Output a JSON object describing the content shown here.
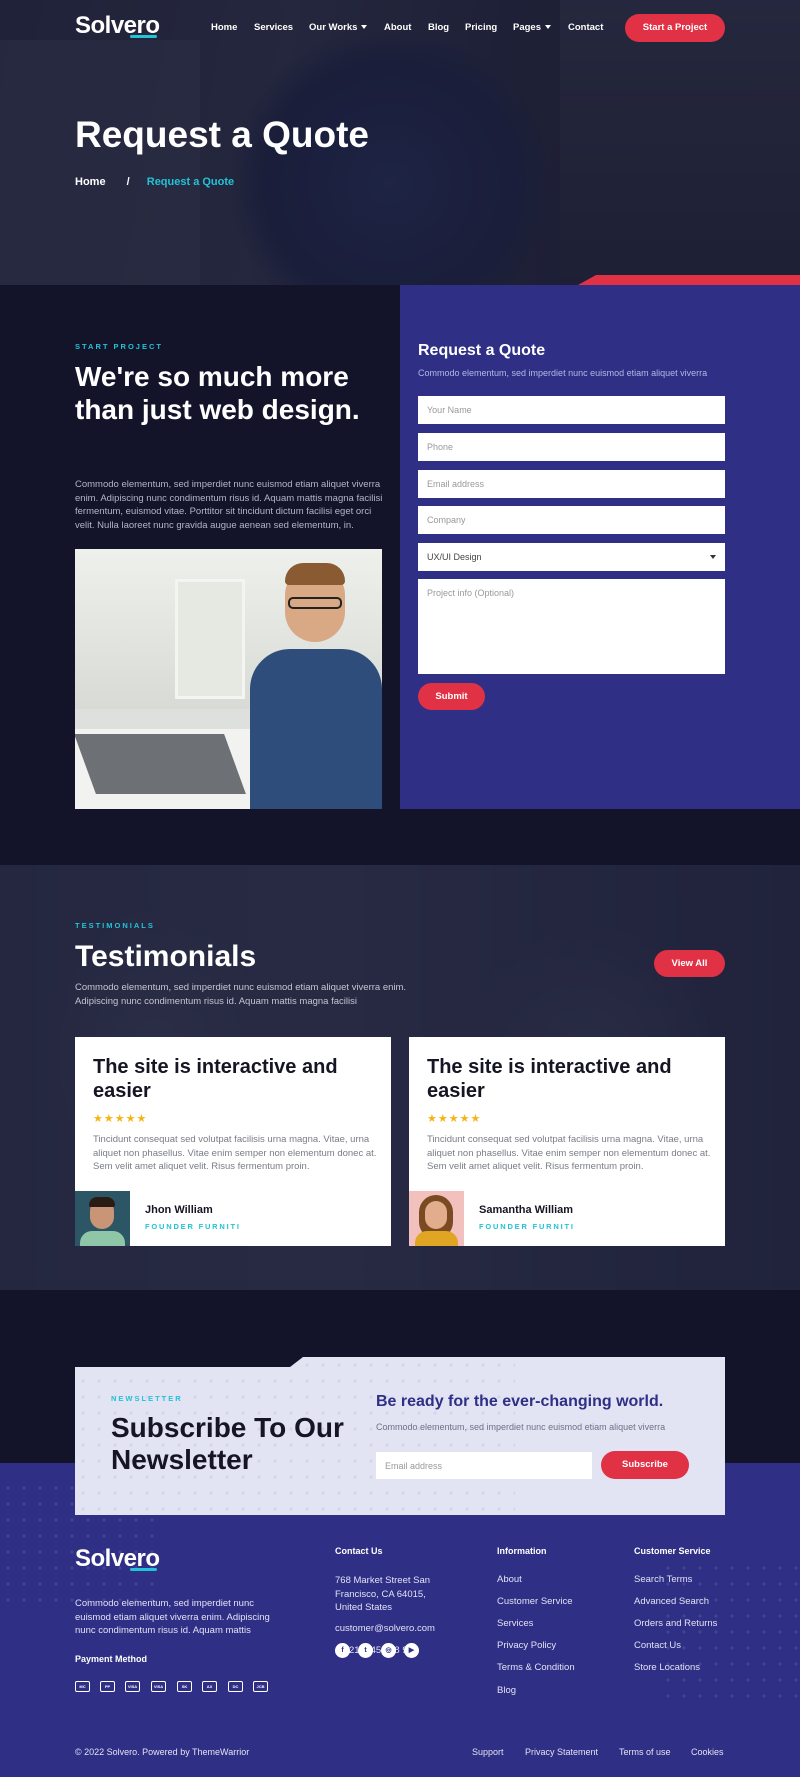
{
  "brand": {
    "name": "Solvero",
    "accent": "#e03145",
    "cyan": "#22c3d6",
    "indigo": "#2f2f86",
    "dark": "#131429"
  },
  "nav": {
    "items": [
      "Home",
      "Services",
      "Our Works",
      "About",
      "Blog",
      "Pricing",
      "Pages",
      "Contact"
    ],
    "cta": "Start a Project"
  },
  "hero": {
    "title": "Request a Quote",
    "breadcrumb": {
      "home": "Home",
      "separator": "/",
      "current": "Request a Quote"
    }
  },
  "intro": {
    "eyebrow": "START PROJECT",
    "title": "We're so much more than just web design.",
    "text": "Commodo elementum, sed imperdiet nunc euismod etiam aliquet viverra enim. Adipiscing nunc condimentum risus id. Aquam mattis magna facilisi fermentum, euismod vitae. Porttitor sit tincidunt dictum facilisi eget orci velit. Nulla laoreet nunc gravida augue aenean sed elementum, in."
  },
  "quote_form": {
    "title": "Request a Quote",
    "subtitle": "Commodo elementum, sed imperdiet nunc euismod etiam aliquet viverra",
    "name_placeholder": "Your Name",
    "phone_placeholder": "Phone",
    "email_placeholder": "Email address",
    "company_placeholder": "Company",
    "service_value": "UX/UI Design",
    "info_placeholder": "Project info (Optional)",
    "submit": "Submit"
  },
  "testimonials": {
    "eyebrow": "TESTIMONIALS",
    "title": "Testimonials",
    "text": "Commodo elementum, sed imperdiet nunc euismod etiam aliquet viverra enim. Adipiscing nunc condimentum risus id. Aquam mattis magna facilisi",
    "view_all": "View All",
    "cards": [
      {
        "title": "The site is interactive and easier",
        "rating": 5,
        "stars": "★★★★★",
        "text": "Tincidunt consequat sed volutpat facilisis urna magna. Vitae, urna aliquet non phasellus. Vitae enim semper non elementum donec at. Sem velit amet aliquet velit. Risus fermentum proin.",
        "author": "Jhon William",
        "role": "FOUNDER FURNITI"
      },
      {
        "title": "The site is interactive and easier",
        "rating": 5,
        "stars": "★★★★★",
        "text": "Tincidunt consequat sed volutpat facilisis urna magna. Vitae, urna aliquet non phasellus. Vitae enim semper non elementum donec at. Sem velit amet aliquet velit. Risus fermentum proin.",
        "author": "Samantha William",
        "role": "FOUNDER FURNITI"
      }
    ]
  },
  "newsletter": {
    "eyebrow": "NEWSLETTER",
    "title": "Subscribe To Our Newsletter",
    "heading": "Be ready for the ever-changing world.",
    "text": "Commodo elementum, sed imperdiet nunc euismod etiam aliquet viverra",
    "email_placeholder": "Email address",
    "button": "Subscribe"
  },
  "footer": {
    "about": "Commodo elementum, sed imperdiet nunc euismod etiam aliquet viverra enim. Adipiscing nunc condimentum risus id. Aquam mattis",
    "payment_title": "Payment Method",
    "payment_icons": [
      "mastercard",
      "paypal",
      "visa",
      "visa",
      "skrill",
      "amex",
      "diners",
      "jcb"
    ],
    "contact": {
      "title": "Contact Us",
      "address": "768 Market Street San Francisco, CA 64015, United States",
      "email": "customer@solvero.com",
      "phone": "(+021) 345 678 910"
    },
    "social_icons": [
      "facebook-icon",
      "twitter-icon",
      "dribbble-icon",
      "youtube-icon"
    ],
    "info": {
      "title": "Information",
      "links": [
        "About",
        "Customer Service",
        "Services",
        "Privacy Policy",
        "Terms & Condition",
        "Blog"
      ]
    },
    "service": {
      "title": "Customer Service",
      "links": [
        "Search Terms",
        "Advanced Search",
        "Orders and Returns",
        "Contact Us",
        "Store Locations"
      ]
    },
    "copyright": "© 2022 Solvero. Powered by ThemeWarrior",
    "bottom_links": [
      "Support",
      "Privacy Statement",
      "Terms of use",
      "Cookies"
    ]
  }
}
